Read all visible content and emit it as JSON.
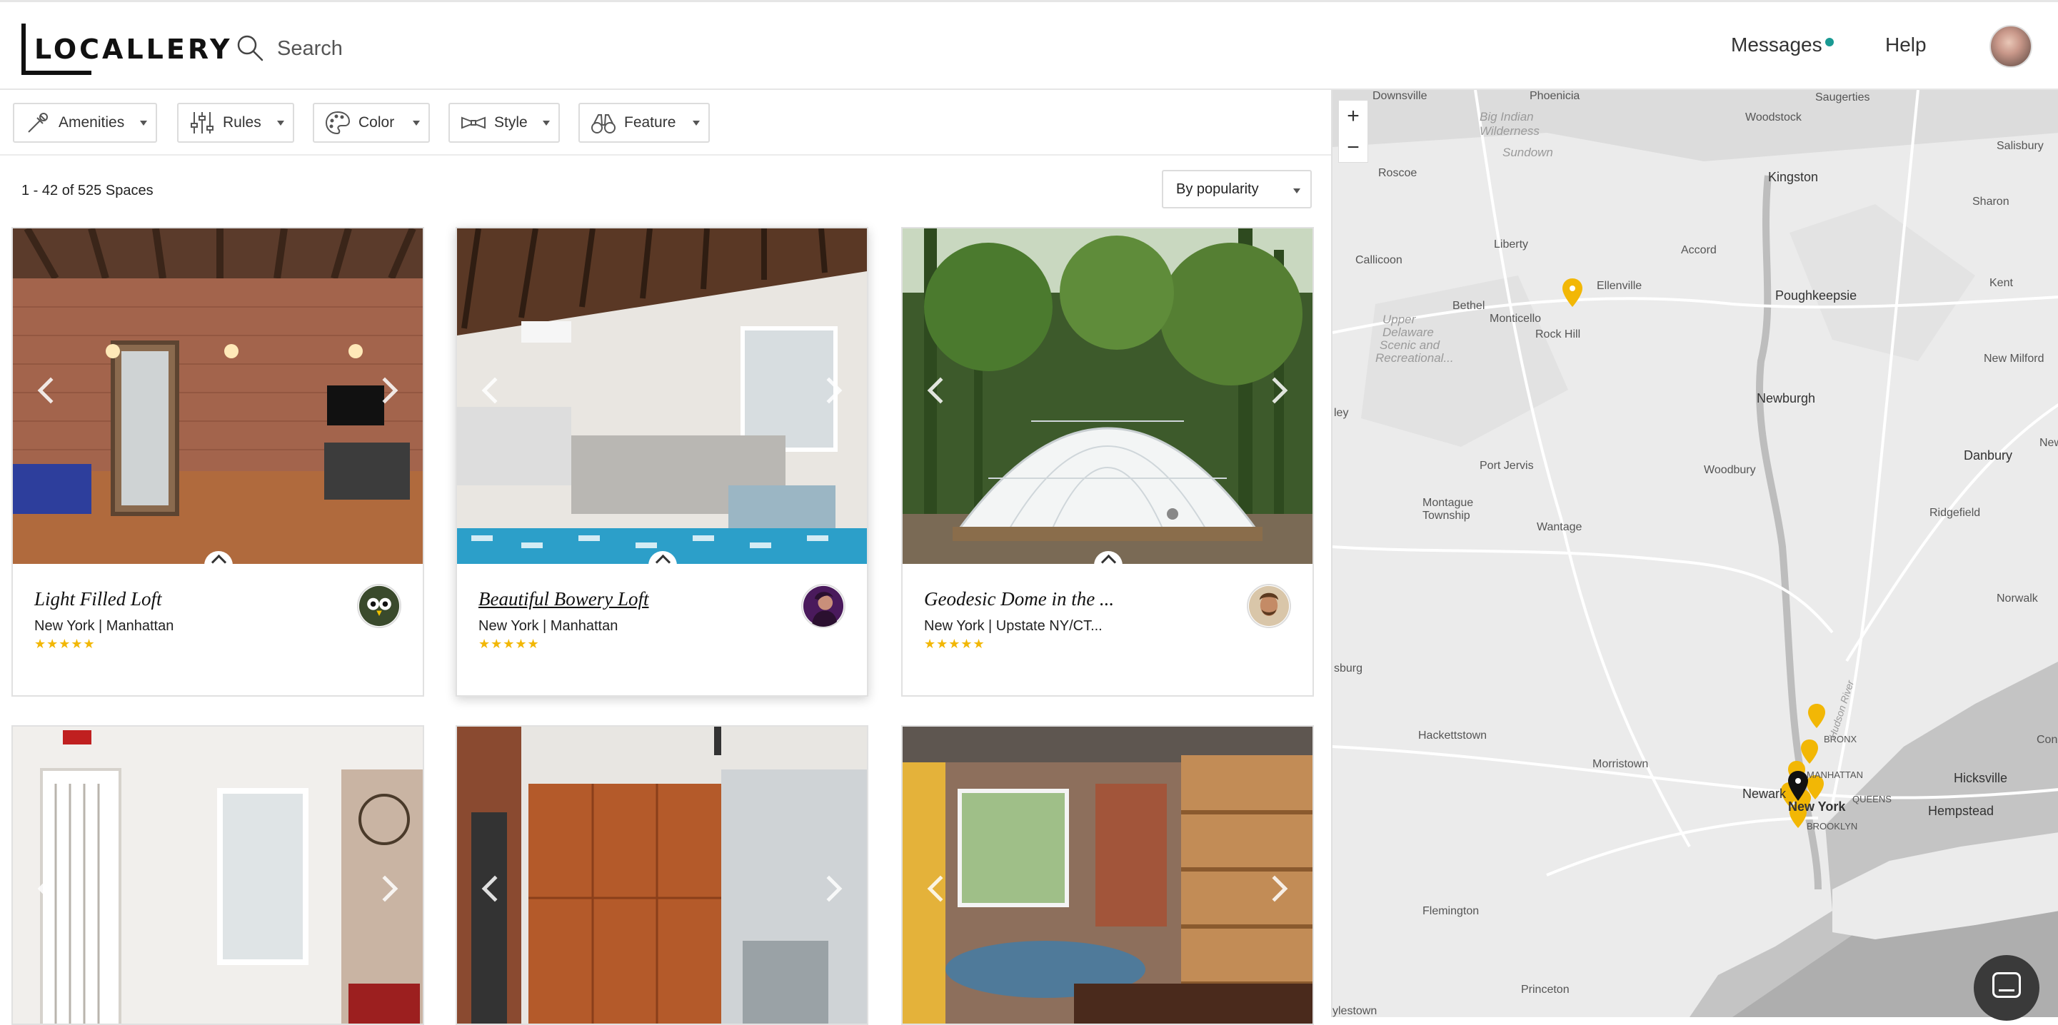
{
  "header": {
    "logo_text": "LOCALLERY",
    "search_placeholder": "Search",
    "messages_label": "Messages",
    "help_label": "Help"
  },
  "filters": [
    {
      "label": "Amenities",
      "icon": "amenities-icon"
    },
    {
      "label": "Rules",
      "icon": "rules-sliders-icon"
    },
    {
      "label": "Color",
      "icon": "palette-icon"
    },
    {
      "label": "Style",
      "icon": "bowtie-icon"
    },
    {
      "label": "Feature",
      "icon": "binoculars-icon"
    }
  ],
  "results": {
    "count_text": "1 - 42 of 525 Spaces",
    "sort_value": "By popularity"
  },
  "listings": [
    {
      "title": "Light Filled Loft",
      "location": "New York | Manhattan",
      "rating": 5,
      "stars": "★★★★★",
      "host_avatar": "owl-avatar"
    },
    {
      "title": "Beautiful Bowery Loft",
      "location": "New York | Manhattan",
      "rating": 5,
      "stars": "★★★★★",
      "host_avatar": "woman-avatar"
    },
    {
      "title": "Geodesic Dome in the ...",
      "location": "New York | Upstate NY/CT...",
      "rating": 5,
      "stars": "★★★★★",
      "host_avatar": "man-avatar"
    }
  ],
  "map": {
    "zoom_in": "+",
    "zoom_out": "−",
    "labels": {
      "downsville": "Downsville",
      "phoenicia": "Phoenicia",
      "saugerties": "Saugerties",
      "big_indian": "Big Indian",
      "wilderness": "Wilderness",
      "woodstock": "Woodstock",
      "sundown": "Sundown",
      "salisbury": "Salisbury",
      "roscoe": "Roscoe",
      "kingston": "Kingston",
      "sharon": "Sharon",
      "liberty": "Liberty",
      "accord": "Accord",
      "callicoon": "Callicoon",
      "ellenville": "Ellenville",
      "poughkeepsie": "Poughkeepsie",
      "kent": "Kent",
      "bethel": "Bethel",
      "monticello": "Monticello",
      "rock_hill": "Rock Hill",
      "upper": "Upper",
      "delaware": "Delaware",
      "scenic": "Scenic and",
      "recreational": "Recreational...",
      "new_milford": "New Milford",
      "newburgh": "Newburgh",
      "ley": "ley",
      "port_jervis": "Port Jervis",
      "woodbury": "Woodbury",
      "danbury": "Danbury",
      "montague": "Montague",
      "township": "Township",
      "ridgefield": "Ridgefield",
      "wantage": "Wantage",
      "norwalk": "Norwalk",
      "sburg": "sburg",
      "hackettstown": "Hackettstown",
      "bronx": "BRONX",
      "morristown": "Morristown",
      "manhattan": "MANHATTAN",
      "hicksville": "Hicksville",
      "newark": "Newark",
      "new_york": "New York",
      "queens": "QUEENS",
      "hempstead": "Hempstead",
      "brooklyn": "BROOKLYN",
      "flemington": "Flemington",
      "princeton": "Princeton",
      "lewistown": "ylestown",
      "hudson_river": "Hudson River",
      "con": "Con",
      "new": "New"
    }
  },
  "colors": {
    "accent_teal": "#1a9a93",
    "star_gold": "#f2b705",
    "map_pin_gold": "#f2b705",
    "map_pin_selected": "#111111"
  }
}
